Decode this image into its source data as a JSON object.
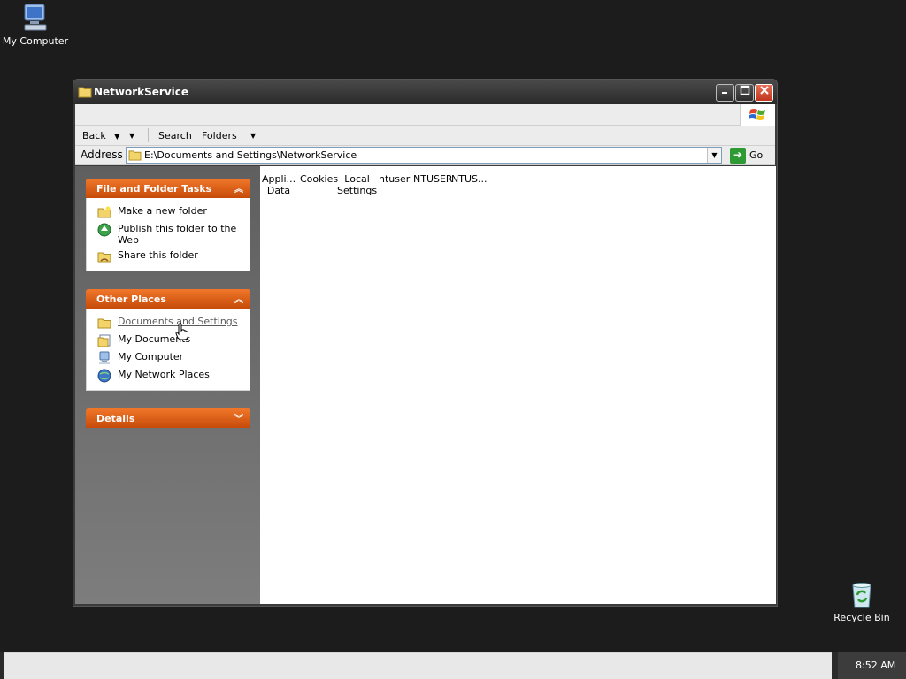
{
  "desktop": {
    "icons": [
      {
        "label": "My Computer",
        "icon": "my-computer-icon"
      },
      {
        "label": "Recycle Bin",
        "icon": "recycle-bin-icon"
      }
    ]
  },
  "window": {
    "title": "NetworkService",
    "toolbar": {
      "back_label": "Back",
      "search_label": "Search",
      "folders_label": "Folders"
    },
    "address": {
      "label": "Address",
      "value": "E:\\Documents and Settings\\NetworkService",
      "go_label": "Go"
    },
    "left_panel": {
      "file_tasks": {
        "title": "File and Folder Tasks",
        "items": [
          "Make a new folder",
          "Publish this folder to the Web",
          "Share this folder"
        ]
      },
      "other_places": {
        "title": "Other Places",
        "items": [
          "Documents and Settings",
          "My Documents",
          "My Computer",
          "My Network Places"
        ]
      },
      "details": {
        "title": "Details"
      }
    },
    "files": [
      {
        "line1": "Appli...",
        "line2": "Data"
      },
      {
        "line1": "Cookies",
        "line2": ""
      },
      {
        "line1": "Local",
        "line2": "Settings"
      },
      {
        "line1": "ntuser",
        "line2": ""
      },
      {
        "line1": "NTUSER",
        "line2": ""
      },
      {
        "line1": "NTUS...",
        "line2": ""
      }
    ]
  },
  "taskbar": {
    "clock": "8:52 AM"
  },
  "colors": {
    "accent_orange": "#e0601a",
    "go_green": "#2e9a33"
  }
}
